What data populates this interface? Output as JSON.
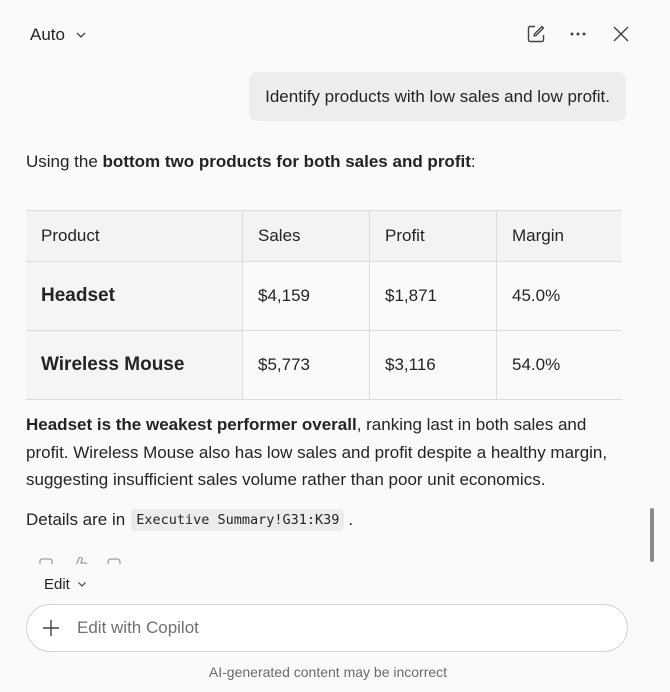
{
  "header": {
    "mode_label": "Auto",
    "icons": [
      "new-chat-icon",
      "more-icon",
      "close-icon"
    ]
  },
  "conversation": {
    "user_message": "Identify products with low sales and low profit.",
    "intro_prefix": "Using the ",
    "intro_bold": "bottom two products for both sales and profit",
    "intro_suffix": ":",
    "table": {
      "headers": [
        "Product",
        "Sales",
        "Profit",
        "Margin"
      ],
      "rows": [
        {
          "product": "Headset",
          "sales": "$4,159",
          "profit": "$1,871",
          "margin": "45.0%"
        },
        {
          "product": "Wireless Mouse",
          "sales": "$5,773",
          "profit": "$3,116",
          "margin": "54.0%"
        }
      ]
    },
    "summary_bold": "Headset is the weakest performer overall",
    "summary_rest": ", ranking last in both sales and profit. Wireless Mouse also has low sales and profit despite a healthy margin, suggesting insufficient sales volume rather than poor unit economics.",
    "details_prefix": "Details are in",
    "details_ref": "Executive Summary!G31:K39",
    "details_suffix": "."
  },
  "composer": {
    "edit_label": "Edit",
    "placeholder": "Edit with Copilot",
    "value": ""
  },
  "footer": {
    "disclaimer": "AI-generated content may be incorrect"
  },
  "colors": {
    "background": "#fafafa",
    "bubble": "#ededed",
    "text": "#242424",
    "muted": "#6b6b6b"
  }
}
